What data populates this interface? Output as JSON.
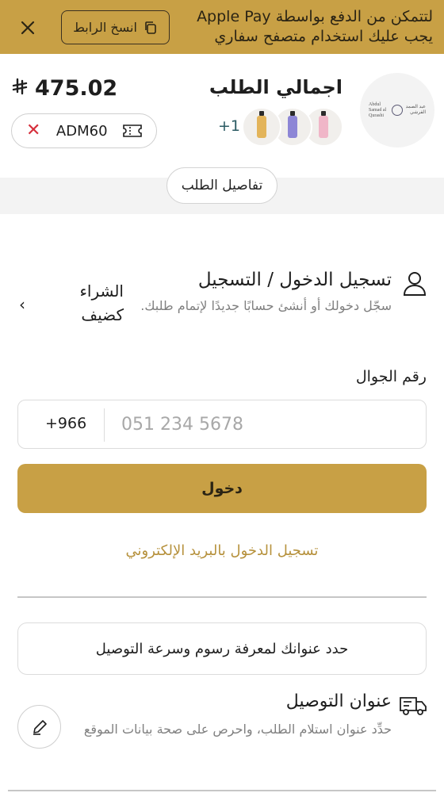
{
  "banner": {
    "message": "لتتمكن من الدفع بواسطة Apple Pay يجب عليك استخدام متصفح سفاري",
    "copy_link_label": "انسخ الرابط",
    "close_icon": "close-icon"
  },
  "order": {
    "title": "اجمالي الطلب",
    "total": "475.02",
    "currency_symbol": "⃁",
    "extra_items": "+1",
    "thumbnails": [
      {
        "name": "product-thumb-1",
        "color": "#f0b6c8"
      },
      {
        "name": "product-thumb-2",
        "color": "#8d86d6"
      },
      {
        "name": "product-thumb-3",
        "color": "#e3b45a"
      }
    ],
    "logo_text_en": "Abdul Samad al Qurashi",
    "logo_text_ar": "عبد الصمد القرشي"
  },
  "coupon": {
    "code": "ADM60",
    "icon": "ticket-icon",
    "remove_icon": "close-icon"
  },
  "details": {
    "label": "تفاصيل الطلب"
  },
  "login": {
    "title": "تسجيل الدخول / التسجيل",
    "subtitle": "سجّل دخولك أو أنشئ حسابًا جديدًا لإتمام طلبك.",
    "guest_label": "الشراء كضيف",
    "phone_label": "رقم الجوال",
    "country_code": "+966",
    "phone_placeholder": "051 234 5678",
    "submit_label": "دخول",
    "email_link": "تسجيل الدخول بالبريد الإلكتروني"
  },
  "delivery": {
    "prompt": "حدد عنوانك لمعرفة رسوم وسرعة التوصيل",
    "title": "عنوان التوصيل",
    "subtitle": "حدِّد عنوان استلام الطلب، واحرص على صحة بيانات الموقع"
  },
  "colors": {
    "accent": "#c8a045",
    "link": "#b6913c",
    "danger": "#d62f3c"
  }
}
